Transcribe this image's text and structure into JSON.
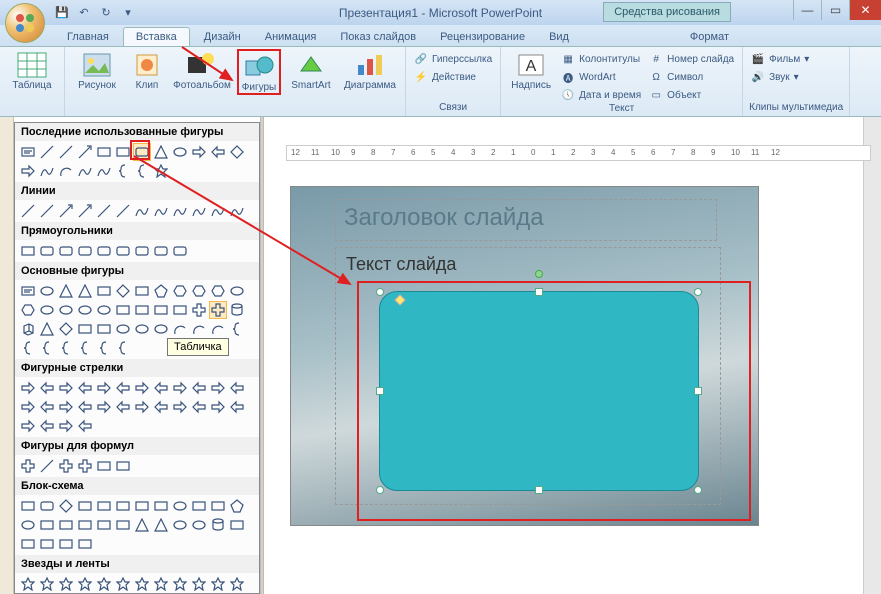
{
  "title": "Презентация1 - Microsoft PowerPoint",
  "context_tool": "Средства рисования",
  "tabs": {
    "home": "Главная",
    "insert": "Вставка",
    "design": "Дизайн",
    "anim": "Анимация",
    "slideshow": "Показ слайдов",
    "review": "Рецензирование",
    "view": "Вид",
    "format": "Формат"
  },
  "ribbon": {
    "table": "Таблица",
    "picture": "Рисунок",
    "clip": "Клип",
    "album": "Фотоальбом",
    "shapes": "Фигуры",
    "smartart": "SmartArt",
    "chart": "Диаграмма",
    "hyperlink": "Гиперссылка",
    "action": "Действие",
    "textbox": "Надпись",
    "headerfooter": "Колонтитулы",
    "wordart": "WordArt",
    "datetime": "Дата и время",
    "slidenum": "Номер слайда",
    "symbol": "Символ",
    "object": "Объект",
    "movie": "Фильм",
    "sound": "Звук",
    "group_links": "Связи",
    "group_text": "Текст",
    "group_media": "Клипы мультимедиа"
  },
  "shapes_panel": {
    "recent": "Последние использованные фигуры",
    "lines": "Линии",
    "rects": "Прямоугольники",
    "basic": "Основные фигуры",
    "arrows": "Фигурные стрелки",
    "formula": "Фигуры для формул",
    "flowchart": "Блок-схема",
    "stars": "Звезды и ленты"
  },
  "tooltip": "Табличка",
  "slide": {
    "title_placeholder": "Заголовок слайда",
    "text_placeholder": "Текст слайда"
  },
  "ruler_marks": [
    "12",
    "11",
    "10",
    "9",
    "8",
    "7",
    "6",
    "5",
    "4",
    "3",
    "2",
    "1",
    "0",
    "1",
    "2",
    "3",
    "4",
    "5",
    "6",
    "7",
    "8",
    "9",
    "10",
    "11",
    "12"
  ]
}
